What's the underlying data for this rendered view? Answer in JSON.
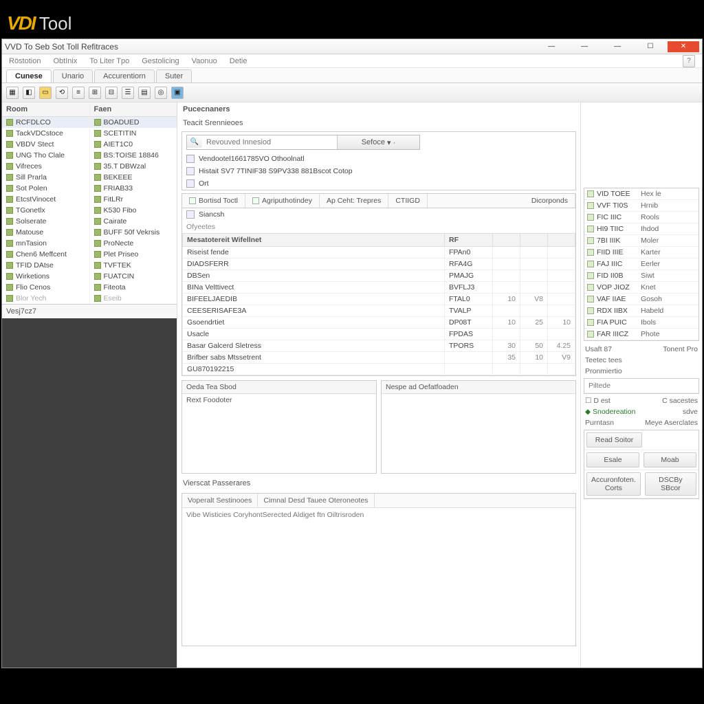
{
  "brand": {
    "logo_prefix": "VDI",
    "logo_suffix": "Tool"
  },
  "window": {
    "title": "VVD To Seb Sot Toll Refitraces"
  },
  "menus": [
    "Röstotion",
    "ObtInix",
    "To Liter Tpo",
    "Gestolicing",
    "Vaonuo",
    "Detie"
  ],
  "doc_tabs": [
    "Cunese",
    "Unario",
    "Accurentiorn",
    "Suter"
  ],
  "toolbar_icons": [
    "grid-icon",
    "open-icon",
    "fold-icon",
    "link-icon",
    "db-icon",
    "table-icon",
    "chart-icon",
    "props-icon",
    "car-icon",
    "diag-icon",
    "module-icon"
  ],
  "left": {
    "tree1_head": "Room",
    "tree2_head": "Faen",
    "tree1": [
      {
        "label": "RCFDLCO",
        "sel": true
      },
      {
        "label": "TackVDCstoce"
      },
      {
        "label": "VBDV Stect"
      },
      {
        "label": "UNG Tho Clale"
      },
      {
        "label": "Vifreces"
      },
      {
        "label": "Sill Prarla"
      },
      {
        "label": "Sot Polen"
      },
      {
        "label": "EtcstVinocet"
      },
      {
        "label": "TGonetlx"
      },
      {
        "label": "Solserate"
      },
      {
        "label": "Matouse"
      },
      {
        "label": "mnTasion"
      },
      {
        "label": "Chen6 Meffcent"
      },
      {
        "label": "TFID DAtse"
      },
      {
        "label": "Wirketions"
      },
      {
        "label": "Flio Cenos"
      },
      {
        "label": "Blor Yech",
        "dim": true
      }
    ],
    "tree2": [
      {
        "label": "BOADUED",
        "sel": true
      },
      {
        "label": "SCETITIN"
      },
      {
        "label": "AIET1C0"
      },
      {
        "label": "BS:TOISE 18846"
      },
      {
        "label": "35.T DBWzal"
      },
      {
        "label": "BEKEEE"
      },
      {
        "label": "FRIAB33"
      },
      {
        "label": "FitLRr"
      },
      {
        "label": "K530 Fibo"
      },
      {
        "label": "Cairate"
      },
      {
        "label": "BUFF 50f Vekrsis"
      },
      {
        "label": "ProNecte"
      },
      {
        "label": "Plet Priseo"
      },
      {
        "label": "TVFTEK"
      },
      {
        "label": "FUATCIN"
      },
      {
        "label": "Fiteota"
      },
      {
        "label": "Eseib",
        "dim": true
      }
    ],
    "key_box": "Vesj7cz7"
  },
  "center": {
    "heading": "Pucecnaners",
    "sub_heading": "Teacit Srennieoes",
    "search_placeholder": "Revouved Innesiod",
    "search_dd": "Sefoce",
    "quick_rows": [
      "Vendootel1661785VO Othoolnatl",
      "Histait SV7 7TINIF38 S9PV338 881Bscot Cotop",
      "Ort"
    ],
    "inner_tabs": [
      "Bortisd Toctl",
      "Agriputhotindey",
      "Ap Ceht: Trepres",
      "CTIIGD",
      "Dicorponds"
    ],
    "subtab": "Siancsh",
    "grid_section": "Ofyeetes",
    "grid_head": [
      "Mesatotereit Wifellnet",
      "RF"
    ],
    "grid_rows": [
      {
        "name": "Riseist fende",
        "code": "FPAn0",
        "n1": "",
        "n2": "",
        "n3": ""
      },
      {
        "name": "DIADSFERR",
        "code": "RFA4G",
        "n1": "",
        "n2": "",
        "n3": ""
      },
      {
        "name": "DBSen",
        "code": "PMAJG",
        "n1": "",
        "n2": "",
        "n3": ""
      },
      {
        "name": "BINa Velttivect",
        "code": "BVFLJ3",
        "n1": "",
        "n2": "",
        "n3": ""
      },
      {
        "name": "BIFEELJAEDIB",
        "code": "FTAL0",
        "n1": "10",
        "n2": "V8",
        "n3": ""
      },
      {
        "name": "CEESERISAFE3A",
        "code": "TVALP",
        "n1": "",
        "n2": "",
        "n3": ""
      },
      {
        "name": "Gsoendrtiet",
        "code": "DP08T",
        "n1": "10",
        "n2": "25",
        "n3": "10"
      },
      {
        "name": "Usacle",
        "code": "FPDAS",
        "n1": "",
        "n2": "",
        "n3": ""
      },
      {
        "name": "Basar Galcerd Sletress",
        "code": "TPORS",
        "n1": "30",
        "n2": "50",
        "n3": "4.25"
      },
      {
        "name": "Brifber sabs Mtssetrent",
        "code": "",
        "n1": "35",
        "n2": "10",
        "n3": "V9"
      },
      {
        "name": "GU870192215",
        "code": "",
        "n1": "",
        "n2": "",
        "n3": ""
      }
    ],
    "split_a_head": "Oeda Tea Sbod",
    "split_b_head": "Nespe ad Oefatfoaden",
    "split_a_sub": "Rext Foodoter",
    "lower_title": "Vierscat Passerares",
    "lower_tab1": "Voperalt Sestinooes",
    "lower_tab2": "Cimnal Desd Tauee Oteroneotes",
    "lower_text": "Vibe Wisticies CoryhontSerected Aldiget ftn Oiltrisroden"
  },
  "right": {
    "rows": [
      {
        "c1": "VID TOEE",
        "c2": "Hex le"
      },
      {
        "c1": "VVF TI0S",
        "c2": "Hrnib"
      },
      {
        "c1": "FIC IIIC",
        "c2": "Rools"
      },
      {
        "c1": "HI9 TIIC",
        "c2": "Ihdod"
      },
      {
        "c1": "7BI IIIK",
        "c2": "Moler"
      },
      {
        "c1": "FIID IIIE",
        "c2": "Karter"
      },
      {
        "c1": "FAJ IIIC",
        "c2": "Eerler"
      },
      {
        "c1": "FID II0B",
        "c2": "Siwt"
      },
      {
        "c1": "VOP JIOZ",
        "c2": "Knet"
      },
      {
        "c1": "VAF IIAE",
        "c2": "Gosoh"
      },
      {
        "c1": "RDX IIBX",
        "c2": "Habeld"
      },
      {
        "c1": "FIA PUIC",
        "c2": "Ibols"
      },
      {
        "c1": "FAR IIICZ",
        "c2": "Phote"
      }
    ],
    "sub1": "Usaft 87",
    "sub2": "Teetec tees",
    "sub3": "Pronmiertio",
    "sub_val": "Tonent Pro",
    "field_placeholder": "Piltede",
    "chk1": "D est",
    "chk2": "Snodereation",
    "chk3": "Purntasn",
    "side_txt1": "C sacestes",
    "side_txt2": "sdve",
    "side_txt3": "Meye Aserclates",
    "btn_read": "Read Soitor",
    "btn_esalo": "Esale",
    "btn_moab": "Moab",
    "btn_accom": "Accuronfoten. Corts",
    "btn_dscopy": "DSCBy SBcor"
  }
}
